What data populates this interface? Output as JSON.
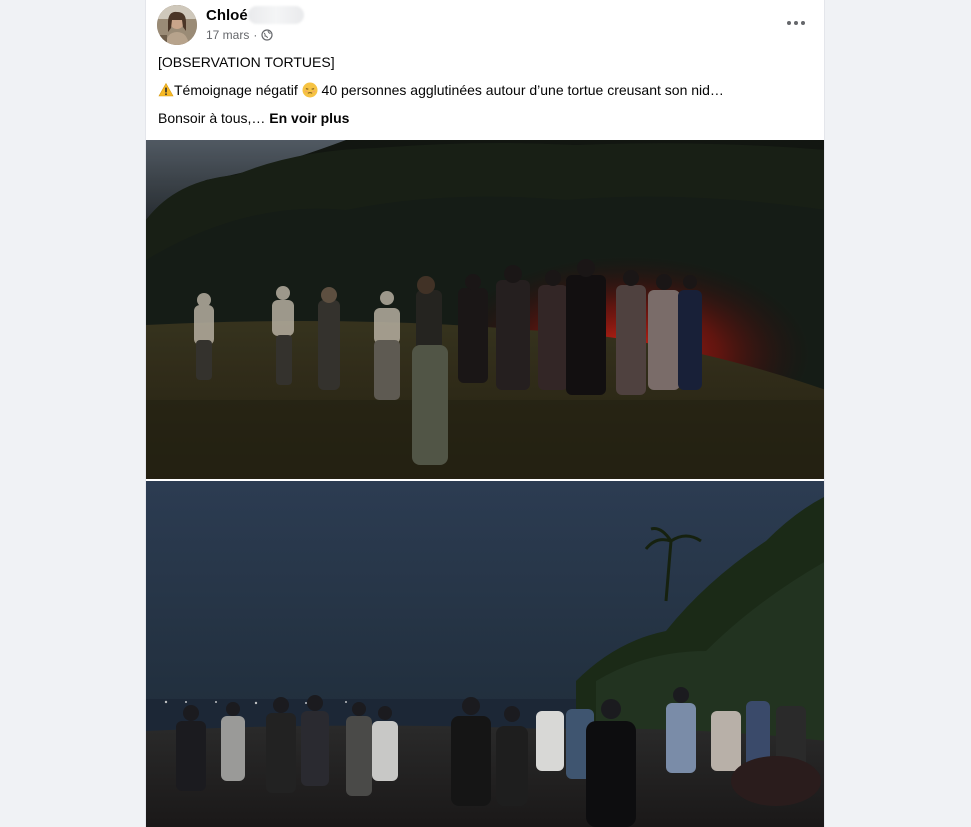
{
  "post": {
    "author": "Chloé",
    "date": "17 mars",
    "separator": "·",
    "audience_icon": "globe-icon",
    "more_icon": "more-horizontal-icon",
    "lines": [
      "[OBSERVATION TORTUES]",
      "Témoignage négatif",
      "40 personnes agglutinées autour d’une tortue creusant son nid…",
      "Bonsoir à tous,…"
    ],
    "emoji": {
      "warning": "warning-icon",
      "sad": "pensive-face-icon"
    },
    "see_more": "En voir plus"
  },
  "photos": [
    {
      "name": "night-beach-red-light-crowd"
    },
    {
      "name": "dusk-beach-crowd"
    }
  ],
  "colors": {
    "name_text": "#050505",
    "meta_text": "#65676b",
    "page_background": "#f0f2f5",
    "card_background": "#ffffff"
  }
}
